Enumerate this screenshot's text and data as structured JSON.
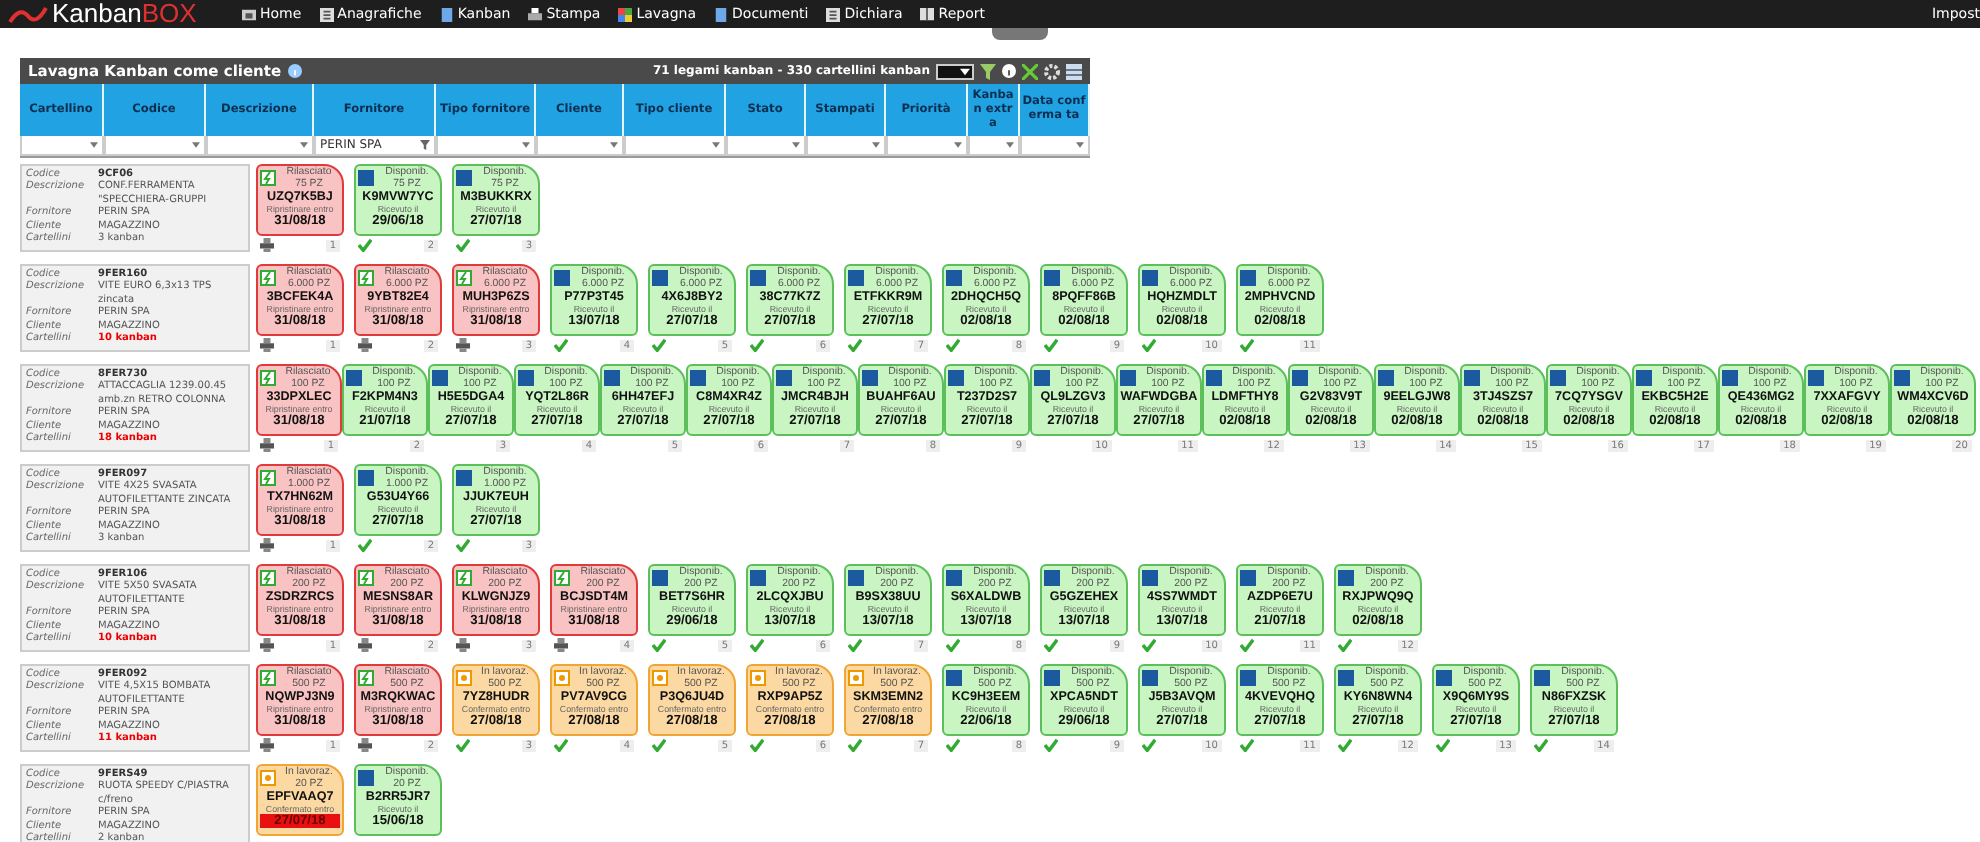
{
  "app": {
    "logo_primary": "Kanban",
    "logo_accent": "BOX"
  },
  "menu": [
    {
      "label": "Home"
    },
    {
      "label": "Anagrafiche"
    },
    {
      "label": "Kanban"
    },
    {
      "label": "Stampa"
    },
    {
      "label": "Lavagna"
    },
    {
      "label": "Documenti"
    },
    {
      "label": "Dichiara"
    },
    {
      "label": "Report"
    }
  ],
  "menu_right": "Impost",
  "board": {
    "title": "Lavagna Kanban come cliente",
    "summary": "71 legami kanban - 330 cartellini kanban",
    "columns": [
      {
        "label": "Cartellino"
      },
      {
        "label": "Codice"
      },
      {
        "label": "Descrizione"
      },
      {
        "label": "Fornitore",
        "filter": "PERIN SPA"
      },
      {
        "label": "Tipo fornitore"
      },
      {
        "label": "Cliente"
      },
      {
        "label": "Tipo cliente"
      },
      {
        "label": "Stato"
      },
      {
        "label": "Stampati"
      },
      {
        "label": "Priorità"
      },
      {
        "label": "Kanban extra"
      },
      {
        "label": "Data conferma ta"
      }
    ]
  },
  "rows": [
    {
      "fields": [
        {
          "label": "Codice",
          "value": "9CF06"
        },
        {
          "label": "Descrizione",
          "value": "CONF.FERRAMENTA \"SPECCHIERA-GRUPPI"
        },
        {
          "label": "Fornitore",
          "value": "PERIN SPA"
        },
        {
          "label": "Cliente",
          "value": "MAGAZZINO"
        },
        {
          "label": "Cartellini",
          "value": "3 kanban",
          "alert": false
        }
      ],
      "cards": [
        {
          "kind": "released",
          "status": "Rilasciato",
          "qty": "75 PZ",
          "code": "UZQ7K5BJ",
          "date_label": "Ripristinare entro",
          "date": "31/08/18",
          "checked": false,
          "number": "1"
        },
        {
          "kind": "available",
          "status": "Disponib.",
          "qty": "75 PZ",
          "code": "K9MVW7YC",
          "date_label": "Ricevuto il",
          "date": "29/06/18",
          "checked": true,
          "number": "2"
        },
        {
          "kind": "available",
          "status": "Disponib.",
          "qty": "75 PZ",
          "code": "M3BUKKRX",
          "date_label": "Ricevuto il",
          "date": "27/07/18",
          "checked": true,
          "number": "3"
        }
      ]
    },
    {
      "fields": [
        {
          "label": "Codice",
          "value": "9FER160"
        },
        {
          "label": "Descrizione",
          "value": "VITE EURO 6,3x13 TPS zincata"
        },
        {
          "label": "Fornitore",
          "value": "PERIN SPA"
        },
        {
          "label": "Cliente",
          "value": "MAGAZZINO"
        },
        {
          "label": "Cartellini",
          "value": "10 kanban",
          "alert": true
        }
      ],
      "cards": [
        {
          "kind": "released",
          "status": "Rilasciato",
          "qty": "6.000 PZ",
          "code": "3BCFEK4A",
          "date_label": "Ripristinare entro",
          "date": "31/08/18",
          "checked": false,
          "number": "1"
        },
        {
          "kind": "released",
          "status": "Rilasciato",
          "qty": "6.000 PZ",
          "code": "9YBT82E4",
          "date_label": "Ripristinare entro",
          "date": "31/08/18",
          "checked": false,
          "number": "2"
        },
        {
          "kind": "released",
          "status": "Rilasciato",
          "qty": "6.000 PZ",
          "code": "MUH3P6ZS",
          "date_label": "Ripristinare entro",
          "date": "31/08/18",
          "checked": false,
          "number": "3"
        },
        {
          "kind": "available",
          "status": "Disponib.",
          "qty": "6.000 PZ",
          "code": "P77P3T45",
          "date_label": "Ricevuto il",
          "date": "13/07/18",
          "checked": true,
          "number": "4"
        },
        {
          "kind": "available",
          "status": "Disponib.",
          "qty": "6.000 PZ",
          "code": "4X6J8BY2",
          "date_label": "Ricevuto il",
          "date": "27/07/18",
          "checked": true,
          "number": "5"
        },
        {
          "kind": "available",
          "status": "Disponib.",
          "qty": "6.000 PZ",
          "code": "38C77K7Z",
          "date_label": "Ricevuto il",
          "date": "27/07/18",
          "checked": true,
          "number": "6"
        },
        {
          "kind": "available",
          "status": "Disponib.",
          "qty": "6.000 PZ",
          "code": "ETFKKR9M",
          "date_label": "Ricevuto il",
          "date": "27/07/18",
          "checked": true,
          "number": "7"
        },
        {
          "kind": "available",
          "status": "Disponib.",
          "qty": "6.000 PZ",
          "code": "2DHQCH5Q",
          "date_label": "Ricevuto il",
          "date": "02/08/18",
          "checked": true,
          "number": "8"
        },
        {
          "kind": "available",
          "status": "Disponib.",
          "qty": "6.000 PZ",
          "code": "8PQFF86B",
          "date_label": "Ricevuto il",
          "date": "02/08/18",
          "checked": true,
          "number": "9"
        },
        {
          "kind": "available",
          "status": "Disponib.",
          "qty": "6.000 PZ",
          "code": "HQHZMDLT",
          "date_label": "Ricevuto il",
          "date": "02/08/18",
          "checked": true,
          "number": "10"
        },
        {
          "kind": "available",
          "status": "Disponib.",
          "qty": "6.000 PZ",
          "code": "2MPHVCND",
          "date_label": "Ricevuto il",
          "date": "02/08/18",
          "checked": true,
          "number": "11"
        }
      ]
    },
    {
      "fields": [
        {
          "label": "Codice",
          "value": "8FER730"
        },
        {
          "label": "Descrizione",
          "value": "ATTACCAGLIA 1239.00.45 amb.zn RETRO COLONNA"
        },
        {
          "label": "Fornitore",
          "value": "PERIN SPA"
        },
        {
          "label": "Cliente",
          "value": "MAGAZZINO"
        },
        {
          "label": "Cartellini",
          "value": "18 kanban",
          "alert": true
        }
      ],
      "cards": [
        {
          "kind": "released",
          "status": "Rilasciato",
          "qty": "100 PZ",
          "code": "33DPXLEC",
          "date_label": "Ripristinare entro",
          "date": "31/08/18",
          "checked": false,
          "number": "1"
        },
        {
          "kind": "available",
          "status": "Disponib.",
          "qty": "100 PZ",
          "code": "F2KPM4N3",
          "date_label": "Ricevuto il",
          "date": "21/07/18",
          "checked": false,
          "number": "2"
        },
        {
          "kind": "available",
          "status": "Disponib.",
          "qty": "100 PZ",
          "code": "H5E5DGA4",
          "date_label": "Ricevuto il",
          "date": "27/07/18",
          "checked": false,
          "number": "3"
        },
        {
          "kind": "available",
          "status": "Disponib.",
          "qty": "100 PZ",
          "code": "YQT2L86R",
          "date_label": "Ricevuto il",
          "date": "27/07/18",
          "checked": false,
          "number": "4"
        },
        {
          "kind": "available",
          "status": "Disponib.",
          "qty": "100 PZ",
          "code": "6HH47EFJ",
          "date_label": "Ricevuto il",
          "date": "27/07/18",
          "checked": false,
          "number": "5"
        },
        {
          "kind": "available",
          "status": "Disponib.",
          "qty": "100 PZ",
          "code": "C8M4XR4Z",
          "date_label": "Ricevuto il",
          "date": "27/07/18",
          "checked": false,
          "number": "6"
        },
        {
          "kind": "available",
          "status": "Disponib.",
          "qty": "100 PZ",
          "code": "JMCR4BJH",
          "date_label": "Ricevuto il",
          "date": "27/07/18",
          "checked": false,
          "number": "7"
        },
        {
          "kind": "available",
          "status": "Disponib.",
          "qty": "100 PZ",
          "code": "BUAHF6AU",
          "date_label": "Ricevuto il",
          "date": "27/07/18",
          "checked": false,
          "number": "8"
        },
        {
          "kind": "available",
          "status": "Disponib.",
          "qty": "100 PZ",
          "code": "T237D2S7",
          "date_label": "Ricevuto il",
          "date": "27/07/18",
          "checked": false,
          "number": "9"
        },
        {
          "kind": "available",
          "status": "Disponib.",
          "qty": "100 PZ",
          "code": "QL9LZGV3",
          "date_label": "Ricevuto il",
          "date": "27/07/18",
          "checked": false,
          "number": "10"
        },
        {
          "kind": "available",
          "status": "Disponib.",
          "qty": "100 PZ",
          "code": "WAFWDGBA",
          "date_label": "Ricevuto il",
          "date": "27/07/18",
          "checked": false,
          "number": "11"
        },
        {
          "kind": "available",
          "status": "Disponib.",
          "qty": "100 PZ",
          "code": "LDMFTHY8",
          "date_label": "Ricevuto il",
          "date": "02/08/18",
          "checked": false,
          "number": "12"
        },
        {
          "kind": "available",
          "status": "Disponib.",
          "qty": "100 PZ",
          "code": "G2V83V9T",
          "date_label": "Ricevuto il",
          "date": "02/08/18",
          "checked": false,
          "number": "13"
        },
        {
          "kind": "available",
          "status": "Disponib.",
          "qty": "100 PZ",
          "code": "9EELGJW8",
          "date_label": "Ricevuto il",
          "date": "02/08/18",
          "checked": false,
          "number": "14"
        },
        {
          "kind": "available",
          "status": "Disponib.",
          "qty": "100 PZ",
          "code": "3TJ4SZS7",
          "date_label": "Ricevuto il",
          "date": "02/08/18",
          "checked": false,
          "number": "15"
        },
        {
          "kind": "available",
          "status": "Disponib.",
          "qty": "100 PZ",
          "code": "7CQ7YSGV",
          "date_label": "Ricevuto il",
          "date": "02/08/18",
          "checked": false,
          "number": "16"
        },
        {
          "kind": "available",
          "status": "Disponib.",
          "qty": "100 PZ",
          "code": "EKBC5H2E",
          "date_label": "Ricevuto il",
          "date": "02/08/18",
          "checked": false,
          "number": "17"
        },
        {
          "kind": "available",
          "status": "Disponib.",
          "qty": "100 PZ",
          "code": "QE436MG2",
          "date_label": "Ricevuto il",
          "date": "02/08/18",
          "checked": false,
          "number": "18"
        },
        {
          "kind": "available",
          "status": "Disponib.",
          "qty": "100 PZ",
          "code": "7XXAFGVY",
          "date_label": "Ricevuto il",
          "date": "02/08/18",
          "checked": false,
          "number": "19"
        },
        {
          "kind": "available",
          "status": "Disponib.",
          "qty": "100 PZ",
          "code": "WM4XCV6D",
          "date_label": "Ricevuto il",
          "date": "02/08/18",
          "checked": false,
          "number": "20"
        }
      ]
    },
    {
      "fields": [
        {
          "label": "Codice",
          "value": "9FER097"
        },
        {
          "label": "Descrizione",
          "value": "VITE 4X25 SVASATA AUTOFILETTANTE ZINCATA"
        },
        {
          "label": "Fornitore",
          "value": "PERIN SPA"
        },
        {
          "label": "Cliente",
          "value": "MAGAZZINO"
        },
        {
          "label": "Cartellini",
          "value": "3 kanban",
          "alert": false
        }
      ],
      "cards": [
        {
          "kind": "released",
          "status": "Rilasciato",
          "qty": "1.000 PZ",
          "code": "TX7HN62M",
          "date_label": "Ripristinare entro",
          "date": "31/08/18",
          "checked": false,
          "number": "1"
        },
        {
          "kind": "available",
          "status": "Disponib.",
          "qty": "1.000 PZ",
          "code": "G53U4Y66",
          "date_label": "Ricevuto il",
          "date": "27/07/18",
          "checked": true,
          "number": "2"
        },
        {
          "kind": "available",
          "status": "Disponib.",
          "qty": "1.000 PZ",
          "code": "JJUK7EUH",
          "date_label": "Ricevuto il",
          "date": "27/07/18",
          "checked": true,
          "number": "3"
        }
      ]
    },
    {
      "fields": [
        {
          "label": "Codice",
          "value": "9FER106"
        },
        {
          "label": "Descrizione",
          "value": "VITE 5X50 SVASATA AUTOFILETTANTE"
        },
        {
          "label": "Fornitore",
          "value": "PERIN SPA"
        },
        {
          "label": "Cliente",
          "value": "MAGAZZINO"
        },
        {
          "label": "Cartellini",
          "value": "10 kanban",
          "alert": true
        }
      ],
      "cards": [
        {
          "kind": "released",
          "status": "Rilasciato",
          "qty": "200 PZ",
          "code": "ZSDRZRCS",
          "date_label": "Ripristinare entro",
          "date": "31/08/18",
          "checked": false,
          "number": "1"
        },
        {
          "kind": "released",
          "status": "Rilasciato",
          "qty": "200 PZ",
          "code": "MESNS8AR",
          "date_label": "Ripristinare entro",
          "date": "31/08/18",
          "checked": false,
          "number": "2"
        },
        {
          "kind": "released",
          "status": "Rilasciato",
          "qty": "200 PZ",
          "code": "KLWGNJZ9",
          "date_label": "Ripristinare entro",
          "date": "31/08/18",
          "checked": false,
          "number": "3"
        },
        {
          "kind": "released",
          "status": "Rilasciato",
          "qty": "200 PZ",
          "code": "BCJSDT4M",
          "date_label": "Ripristinare entro",
          "date": "31/08/18",
          "checked": false,
          "number": "4"
        },
        {
          "kind": "available",
          "status": "Disponib.",
          "qty": "200 PZ",
          "code": "BET7S6HR",
          "date_label": "Ricevuto il",
          "date": "29/06/18",
          "checked": true,
          "number": "5"
        },
        {
          "kind": "available",
          "status": "Disponib.",
          "qty": "200 PZ",
          "code": "2LCQXJBU",
          "date_label": "Ricevuto il",
          "date": "13/07/18",
          "checked": true,
          "number": "6"
        },
        {
          "kind": "available",
          "status": "Disponib.",
          "qty": "200 PZ",
          "code": "B9SX38UU",
          "date_label": "Ricevuto il",
          "date": "13/07/18",
          "checked": true,
          "number": "7"
        },
        {
          "kind": "available",
          "status": "Disponib.",
          "qty": "200 PZ",
          "code": "S6XALDWB",
          "date_label": "Ricevuto il",
          "date": "13/07/18",
          "checked": true,
          "number": "8"
        },
        {
          "kind": "available",
          "status": "Disponib.",
          "qty": "200 PZ",
          "code": "G5GZEHEX",
          "date_label": "Ricevuto il",
          "date": "13/07/18",
          "checked": true,
          "number": "9"
        },
        {
          "kind": "available",
          "status": "Disponib.",
          "qty": "200 PZ",
          "code": "4SS7WMDT",
          "date_label": "Ricevuto il",
          "date": "13/07/18",
          "checked": true,
          "number": "10"
        },
        {
          "kind": "available",
          "status": "Disponib.",
          "qty": "200 PZ",
          "code": "AZDP6E7U",
          "date_label": "Ricevuto il",
          "date": "21/07/18",
          "checked": true,
          "number": "11"
        },
        {
          "kind": "available",
          "status": "Disponib.",
          "qty": "200 PZ",
          "code": "RXJPWQ9Q",
          "date_label": "Ricevuto il",
          "date": "02/08/18",
          "checked": true,
          "number": "12"
        }
      ]
    },
    {
      "fields": [
        {
          "label": "Codice",
          "value": "9FER092"
        },
        {
          "label": "Descrizione",
          "value": "VITE 4,5X15 BOMBATA AUTOFILETTANTE"
        },
        {
          "label": "Fornitore",
          "value": "PERIN SPA"
        },
        {
          "label": "Cliente",
          "value": "MAGAZZINO"
        },
        {
          "label": "Cartellini",
          "value": "11 kanban",
          "alert": true
        }
      ],
      "cards": [
        {
          "kind": "released",
          "status": "Rilasciato",
          "qty": "500 PZ",
          "code": "NQWPJ3N9",
          "date_label": "Ripristinare entro",
          "date": "31/08/18",
          "checked": false,
          "number": "1"
        },
        {
          "kind": "released",
          "status": "Rilasciato",
          "qty": "500 PZ",
          "code": "M3RQKWAC",
          "date_label": "Ripristinare entro",
          "date": "31/08/18",
          "checked": false,
          "number": "2"
        },
        {
          "kind": "working",
          "status": "In lavoraz.",
          "qty": "500 PZ",
          "code": "7YZ8HUDR",
          "date_label": "Confermato entro",
          "date": "27/08/18",
          "checked": true,
          "number": "3"
        },
        {
          "kind": "working",
          "status": "In lavoraz.",
          "qty": "500 PZ",
          "code": "PV7AV9CG",
          "date_label": "Confermato entro",
          "date": "27/08/18",
          "checked": true,
          "number": "4"
        },
        {
          "kind": "working",
          "status": "In lavoraz.",
          "qty": "500 PZ",
          "code": "P3Q6JU4D",
          "date_label": "Confermato entro",
          "date": "27/08/18",
          "checked": true,
          "number": "5"
        },
        {
          "kind": "working",
          "status": "In lavoraz.",
          "qty": "500 PZ",
          "code": "RXP9AP5Z",
          "date_label": "Confermato entro",
          "date": "27/08/18",
          "checked": true,
          "number": "6"
        },
        {
          "kind": "working",
          "status": "In lavoraz.",
          "qty": "500 PZ",
          "code": "SKM3EMN2",
          "date_label": "Confermato entro",
          "date": "27/08/18",
          "checked": true,
          "number": "7"
        },
        {
          "kind": "available",
          "status": "Disponib.",
          "qty": "500 PZ",
          "code": "KC9H3EEM",
          "date_label": "Ricevuto il",
          "date": "22/06/18",
          "checked": true,
          "number": "8"
        },
        {
          "kind": "available",
          "status": "Disponib.",
          "qty": "500 PZ",
          "code": "XPCA5NDT",
          "date_label": "Ricevuto il",
          "date": "29/06/18",
          "checked": true,
          "number": "9"
        },
        {
          "kind": "available",
          "status": "Disponib.",
          "qty": "500 PZ",
          "code": "J5B3AVQM",
          "date_label": "Ricevuto il",
          "date": "27/07/18",
          "checked": true,
          "number": "10"
        },
        {
          "kind": "available",
          "status": "Disponib.",
          "qty": "500 PZ",
          "code": "4KVEVQHQ",
          "date_label": "Ricevuto il",
          "date": "27/07/18",
          "checked": true,
          "number": "11"
        },
        {
          "kind": "available",
          "status": "Disponib.",
          "qty": "500 PZ",
          "code": "KY6N8WN4",
          "date_label": "Ricevuto il",
          "date": "27/07/18",
          "checked": true,
          "number": "12"
        },
        {
          "kind": "available",
          "status": "Disponib.",
          "qty": "500 PZ",
          "code": "X9Q6MY9S",
          "date_label": "Ricevuto il",
          "date": "27/07/18",
          "checked": true,
          "number": "13"
        },
        {
          "kind": "available",
          "status": "Disponib.",
          "qty": "500 PZ",
          "code": "N86FXZSK",
          "date_label": "Ricevuto il",
          "date": "27/07/18",
          "checked": true,
          "number": "14"
        }
      ]
    },
    {
      "fields": [
        {
          "label": "Codice",
          "value": "9FERS49"
        },
        {
          "label": "Descrizione",
          "value": "RUOTA SPEEDY C/PIASTRA c/freno"
        },
        {
          "label": "Fornitore",
          "value": "PERIN SPA"
        },
        {
          "label": "Cliente",
          "value": "MAGAZZINO"
        },
        {
          "label": "Cartellini",
          "value": "2 kanban",
          "alert": false
        }
      ],
      "cards": [
        {
          "kind": "late",
          "status": "In lavoraz.",
          "qty": "20 PZ",
          "code": "EPFVAAQ7",
          "date_label": "Confermato entro",
          "date": "27/07/18"
        },
        {
          "kind": "available",
          "status": "Disponib.",
          "qty": "20 PZ",
          "code": "B2RR5JR7",
          "date_label": "Ricevuto il",
          "date": "15/06/18"
        }
      ]
    }
  ]
}
